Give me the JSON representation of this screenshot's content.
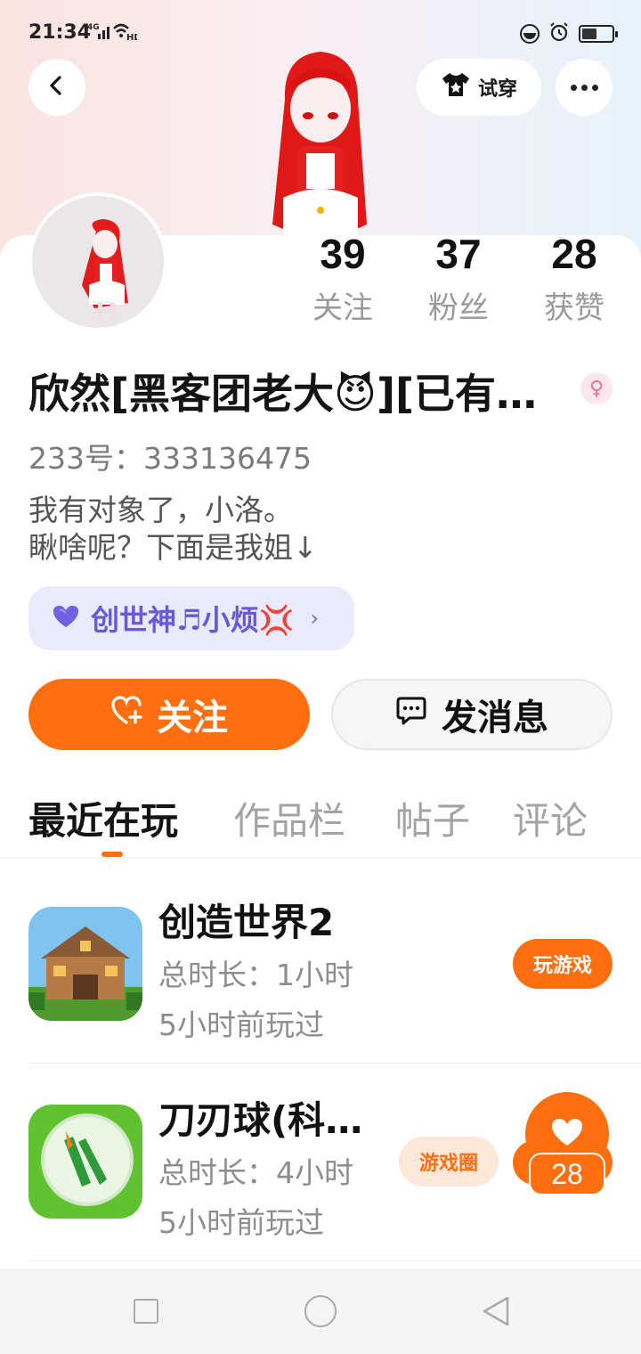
{
  "status_bar": {
    "time": "21:34",
    "network": "4G",
    "hd": "HD",
    "battery_level": 0.5
  },
  "header": {
    "back_icon": "chevron-left-icon",
    "tryon_label": "试穿",
    "tryon_icon": "tshirt-icon",
    "more_icon": "more-dots-icon"
  },
  "profile": {
    "stats": [
      {
        "value": "39",
        "label": "关注"
      },
      {
        "value": "37",
        "label": "粉丝"
      },
      {
        "value": "28",
        "label": "获赞"
      }
    ],
    "name": "欣然[黑客团老大😈][已有…",
    "gender_symbol": "♀",
    "id_line": "233号：333136475",
    "bio_line1": "我有对象了，小洛。",
    "bio_line2": "瞅啥呢？下面是我姐↓",
    "couple_name": "创世神♬小烦💢",
    "couple_arrow": "›"
  },
  "actions": {
    "follow_label": "关注",
    "message_label": "发消息"
  },
  "tabs": [
    {
      "label": "最近在玩",
      "active": true
    },
    {
      "label": "作品栏",
      "active": false
    },
    {
      "label": "帖子",
      "active": false
    },
    {
      "label": "评论",
      "active": false
    }
  ],
  "games": [
    {
      "title": "创造世界2",
      "duration": "总时长：1小时",
      "last_played": "5小时前玩过",
      "button": "玩游戏"
    },
    {
      "title": "刀刃球(科…",
      "duration": "总时长：4小时",
      "last_played": "5小时前玩过",
      "button": "游戏圈"
    }
  ],
  "like_fab": {
    "count": "28"
  },
  "colors": {
    "accent": "#ff6f10",
    "couple_bg": "#ebeafc",
    "couple_text": "#6b58d8",
    "muted_text": "#9a9a9a"
  }
}
